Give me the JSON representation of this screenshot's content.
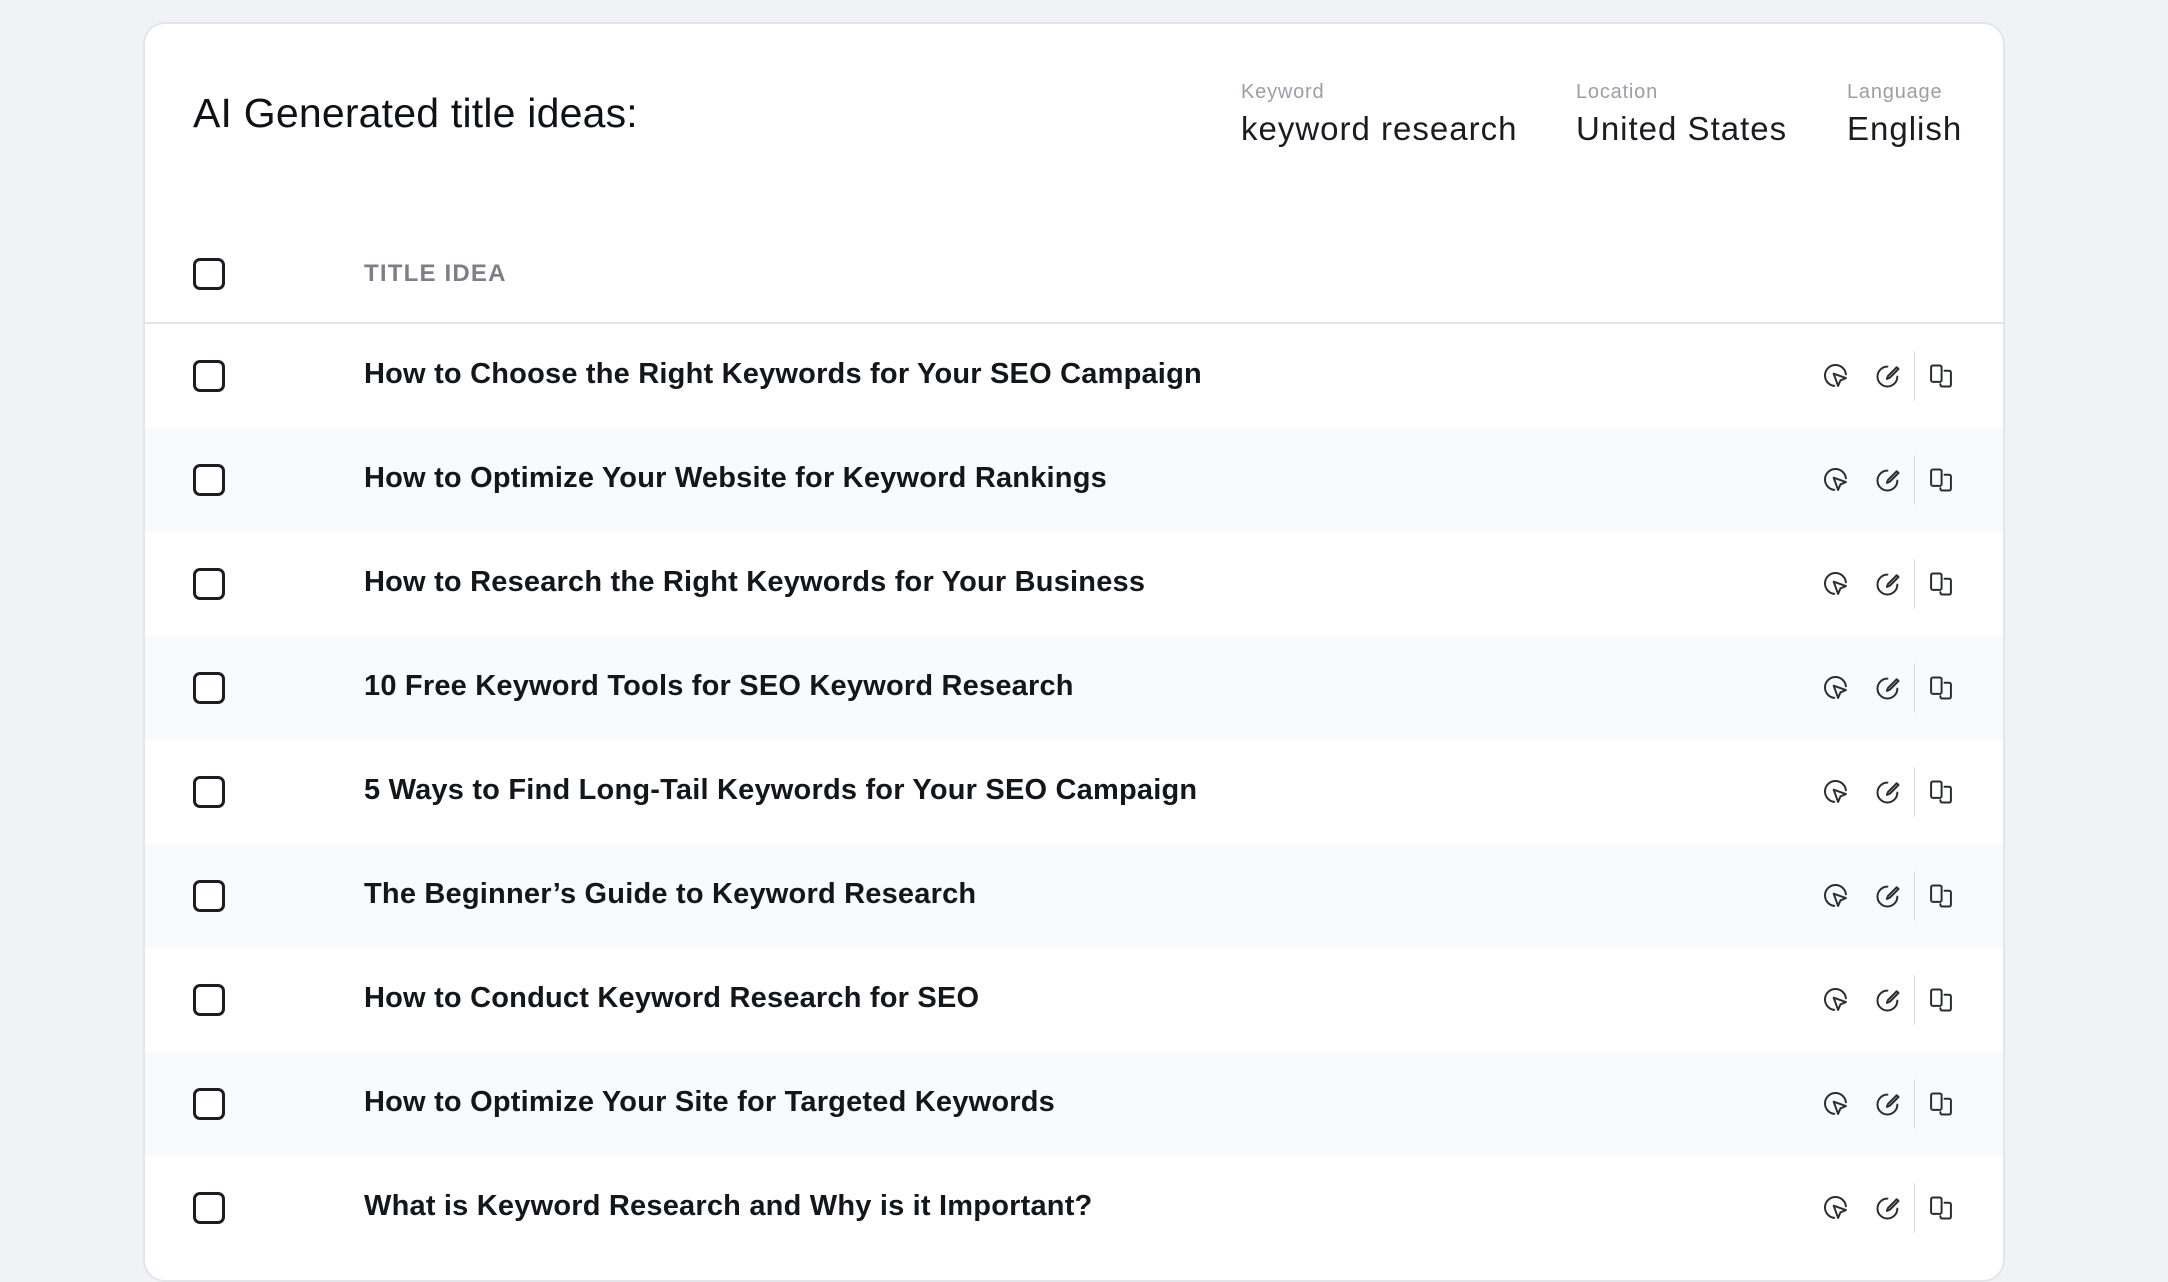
{
  "header": {
    "title": "AI Generated title ideas:",
    "meta": {
      "keyword": {
        "label": "Keyword",
        "value": "keyword research"
      },
      "location": {
        "label": "Location",
        "value": "United States"
      },
      "language": {
        "label": "Language",
        "value": "English"
      }
    }
  },
  "table": {
    "column_header": "TITLE IDEA",
    "rows": [
      {
        "title": "How to Choose the Right Keywords for Your SEO Campaign"
      },
      {
        "title": "How to Optimize Your Website for Keyword Rankings"
      },
      {
        "title": "How to Research the Right Keywords for Your Business"
      },
      {
        "title": "10 Free Keyword Tools for SEO Keyword Research"
      },
      {
        "title": "5 Ways to Find Long-Tail Keywords for Your SEO Campaign"
      },
      {
        "title": "The Beginner’s Guide to Keyword Research"
      },
      {
        "title": "How to Conduct Keyword Research for SEO"
      },
      {
        "title": "How to Optimize Your Site for Targeted Keywords"
      },
      {
        "title": "What is Keyword Research and Why is it Important?"
      }
    ]
  },
  "icons": {
    "select": "cursor-click-icon",
    "edit": "edit-icon",
    "copy": "copy-icon"
  }
}
